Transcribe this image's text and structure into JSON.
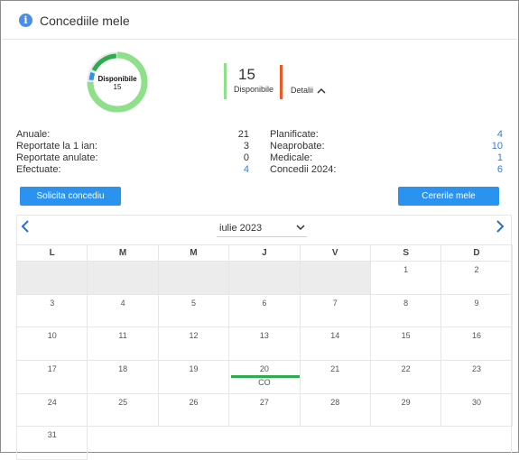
{
  "header": {
    "title": "Concediile mele",
    "icon": "info-icon"
  },
  "donut": {
    "label": "Disponibile",
    "value": "15",
    "available_fraction": 0.75,
    "colors": [
      "#8fe08a",
      "#2eab4f",
      "#2a93f0"
    ]
  },
  "summary": {
    "available_number": "15",
    "available_label": "Disponibile",
    "details_label": "Detalii"
  },
  "stats_left": [
    {
      "label": "Anuale:",
      "value": "21"
    },
    {
      "label": "Reportate la 1 ian:",
      "value": "3"
    },
    {
      "label": "Reportate anulate:",
      "value": "0"
    },
    {
      "label": "Efectuate:",
      "value": "4"
    }
  ],
  "stats_right": [
    {
      "label": "Planificate:",
      "value": "4"
    },
    {
      "label": "Neaprobate:",
      "value": "10"
    },
    {
      "label": "Medicale:",
      "value": "1"
    },
    {
      "label": "Concedii 2024:",
      "value": "6"
    }
  ],
  "buttons": {
    "request": "Solicita concediu",
    "my_requests": "Cererile mele"
  },
  "calendar": {
    "month_label": "iulie 2023",
    "weekdays": [
      "L",
      "M",
      "M",
      "J",
      "V",
      "S",
      "D"
    ],
    "weeks": [
      [
        "",
        "",
        "",
        "",
        "",
        "1",
        "2"
      ],
      [
        "3",
        "4",
        "5",
        "6",
        "7",
        "8",
        "9"
      ],
      [
        "10",
        "11",
        "12",
        "13",
        "14",
        "15",
        "16"
      ],
      [
        "17",
        "18",
        "19",
        "20",
        "21",
        "22",
        "23"
      ],
      [
        "24",
        "25",
        "26",
        "27",
        "28",
        "29",
        "30"
      ],
      [
        "31",
        "",
        "",
        "",
        "",
        "",
        ""
      ]
    ],
    "leave": {
      "day": "20",
      "code": "CO"
    }
  }
}
